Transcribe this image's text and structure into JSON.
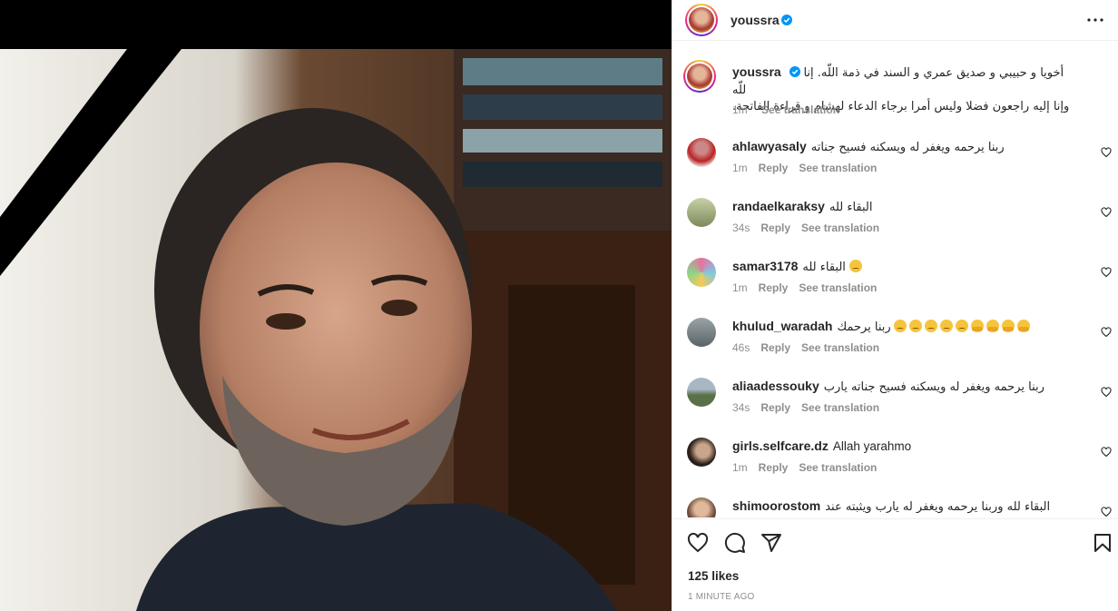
{
  "post": {
    "author": "youssra",
    "caption_line1": "أخويا و حبيبي و صديق عمري و السند في ذمة اللّه. إنا للّه",
    "caption_line2": "وإنا إليه راجعون فضلا وليس أمرا برجاء الدعاء لهشام و قراءة الفاتحة.",
    "caption_time": "1m",
    "see_translation": "See translation",
    "likes": "125 likes",
    "posted": "1 MINUTE AGO"
  },
  "comments": [
    {
      "user": "ahlawyasaly",
      "text": "ربنا يرحمه ويغفر له ويسكنه فسيح جناته",
      "time": "1m",
      "reply": "Reply",
      "translate": "See translation"
    },
    {
      "user": "randaelkaraksy",
      "text": "البقاء لله",
      "time": "34s",
      "reply": "Reply",
      "translate": "See translation"
    },
    {
      "user": "samar3178",
      "text": "البقاء لله",
      "time": "1m",
      "reply": "Reply",
      "translate": "See translation"
    },
    {
      "user": "khulud_waradah",
      "text": "ربنا يرحمك",
      "time": "46s",
      "reply": "Reply",
      "translate": "See translation"
    },
    {
      "user": "aliaadessouky",
      "text": "ربنا يرحمه ويغفر له ويسكنه فسيح جناته يارب",
      "time": "34s",
      "reply": "Reply",
      "translate": "See translation"
    },
    {
      "user": "girls.selfcare.dz",
      "text": "Allah yarahmo",
      "time": "1m",
      "reply": "Reply",
      "translate": "See translation"
    },
    {
      "user": "shimoorostom",
      "text": "البقاء لله وربنا يرحمه ويغفر له يارب ويثبته عند",
      "time": "",
      "reply": "",
      "translate": ""
    }
  ],
  "icons": [
    "more-icon",
    "heart-icon",
    "comment-icon",
    "share-icon",
    "bookmark-icon",
    "verified-icon"
  ],
  "colors": {
    "accent": "#0095f6",
    "muted": "#8e8e8e",
    "text": "#262626"
  }
}
